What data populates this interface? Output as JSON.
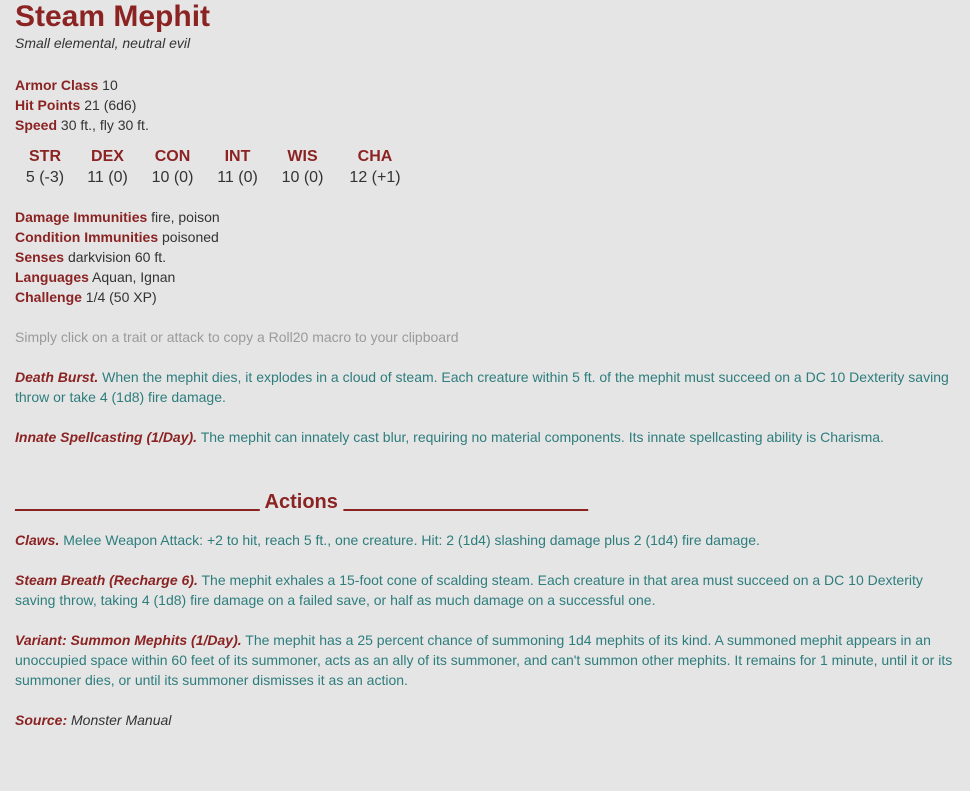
{
  "monster": {
    "name": "Steam Mephit",
    "type": "Small elemental, neutral evil"
  },
  "stats": [
    {
      "label": "Armor Class",
      "value": "10"
    },
    {
      "label": "Hit Points",
      "value": "21 (6d6)"
    },
    {
      "label": "Speed",
      "value": "30 ft., fly 30 ft."
    }
  ],
  "abilities": [
    {
      "name": "STR",
      "value": "5 (-3)"
    },
    {
      "name": "DEX",
      "value": "11 (0)"
    },
    {
      "name": "CON",
      "value": "10 (0)"
    },
    {
      "name": "INT",
      "value": "11 (0)"
    },
    {
      "name": "WIS",
      "value": "10 (0)"
    },
    {
      "name": "CHA",
      "value": "12 (+1)"
    }
  ],
  "details": [
    {
      "label": "Damage Immunities",
      "value": "fire, poison"
    },
    {
      "label": "Condition Immunities",
      "value": "poisoned"
    },
    {
      "label": "Senses",
      "value": "darkvision 60 ft."
    },
    {
      "label": "Languages",
      "value": "Aquan, Ignan"
    },
    {
      "label": "Challenge",
      "value": "1/4 (50 XP)"
    }
  ],
  "hint": "Simply click on a trait or attack to copy a Roll20 macro to your clipboard",
  "traits": [
    {
      "name": "Death Burst.",
      "text": "When the mephit dies, it explodes in a cloud of steam. Each creature within 5 ft. of the mephit must succeed on a DC 10 Dexterity saving throw or take 4 (1d8) fire damage."
    },
    {
      "name": "Innate Spellcasting (1/Day).",
      "text": "The mephit can innately cast blur, requiring no material components. Its innate spellcasting ability is Charisma."
    }
  ],
  "actions_heading": {
    "left_line": "______________________",
    "label": "Actions",
    "right_line": "______________________"
  },
  "actions": [
    {
      "name": "Claws.",
      "text": "Melee Weapon Attack: +2 to hit, reach 5 ft., one creature. Hit: 2 (1d4) slashing damage plus 2 (1d4) fire damage."
    },
    {
      "name": "Steam Breath (Recharge 6).",
      "text": "The mephit exhales a 15-foot cone of scalding steam. Each creature in that area must succeed on a DC 10 Dexterity saving throw, taking 4 (1d8) fire damage on a failed save, or half as much damage on a successful one."
    },
    {
      "name": "Variant: Summon Mephits (1/Day).",
      "text": "The mephit has a 25 percent chance of summoning 1d4 mephits of its kind. A summoned mephit appears in an unoccupied space within 60 feet of its summoner, acts as an ally of its summoner, and can't summon other mephits. It remains for 1 minute, until it or its summoner dies, or until its summoner dismisses it as an action."
    }
  ],
  "source": {
    "label": "Source:",
    "value": "Monster Manual"
  }
}
